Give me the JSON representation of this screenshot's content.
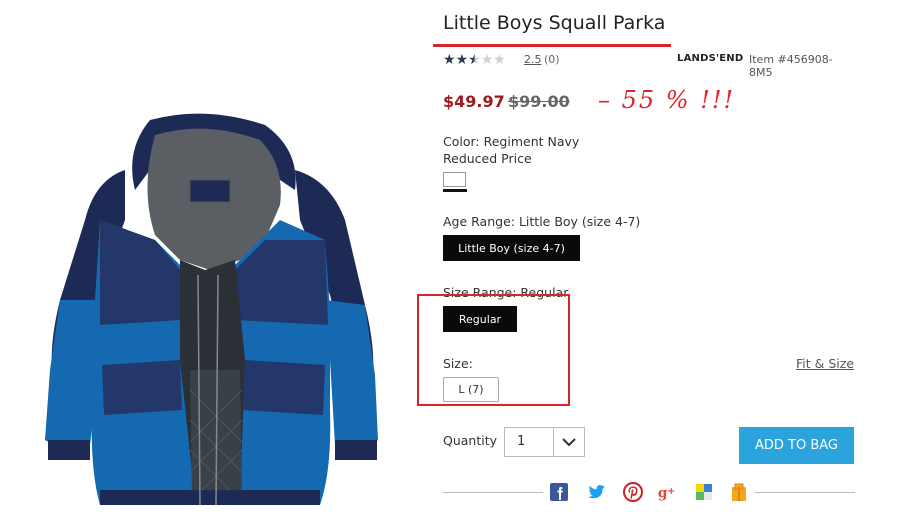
{
  "product": {
    "title": "Little Boys Squall Parka",
    "rating_value": "2.5",
    "rating_stars": 2.5,
    "review_count": "(0)",
    "brand": "LANDS'END",
    "item_number": "Item #456908-8M5",
    "price_sale": "$49.97",
    "price_original": "$99.00",
    "discount_note": "– 55 % !!!"
  },
  "options": {
    "color_label": "Color: Regiment Navy",
    "reduced_label": "Reduced Price",
    "age_range_label": "Age Range: Little Boy (size 4-7)",
    "age_range_button": "Little Boy (size 4-7)",
    "size_range_label": "Size Range: Regular",
    "size_range_button": "Regular",
    "size_label": "Size:",
    "size_button": "L (7)",
    "fit_link": "Fit & Size"
  },
  "purchase": {
    "quantity_label": "Quantity",
    "quantity_value": "1",
    "add_to_bag": "ADD TO BAG"
  },
  "share_icons": [
    "facebook-icon",
    "twitter-icon",
    "pinterest-icon",
    "google-plus-icon",
    "delicious-icon",
    "gift-icon"
  ],
  "colors": {
    "annotation_red": "#d7262b",
    "sale_red": "#a01a1f",
    "add_to_bag_blue": "#2ba3dc",
    "jacket_navy": "#1d2a55",
    "jacket_blue": "#1569b0"
  }
}
